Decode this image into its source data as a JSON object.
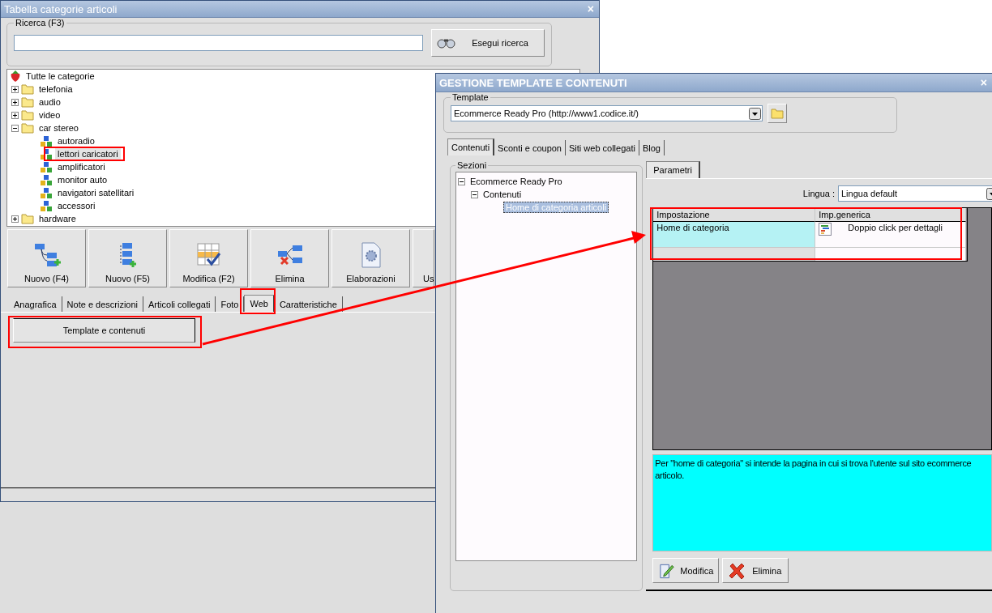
{
  "main_window": {
    "title": "Tabella categorie articoli",
    "close": "×",
    "search": {
      "label": "Ricerca (F3)",
      "button": "Esegui ricerca"
    },
    "tree": [
      {
        "label": "Tutte le categorie",
        "children": [
          {
            "label": "telefonia",
            "expanded": false
          },
          {
            "label": "audio",
            "expanded": false
          },
          {
            "label": "video",
            "expanded": false
          },
          {
            "label": "car stereo",
            "expanded": true,
            "children": [
              {
                "label": "autoradio",
                "selected": false
              },
              {
                "label": "lettori caricatori",
                "selected": true
              },
              {
                "label": "amplificatori",
                "selected": false
              },
              {
                "label": "monitor auto",
                "selected": false
              },
              {
                "label": "navigatori satellitari",
                "selected": false
              },
              {
                "label": "accessori",
                "selected": false
              }
            ]
          },
          {
            "label": "hardware",
            "expanded": false
          }
        ]
      }
    ],
    "toolbar": [
      {
        "label": "Nuovo (F4)"
      },
      {
        "label": "Nuovo (F5)"
      },
      {
        "label": "Modifica (F2)"
      },
      {
        "label": "Elimina"
      },
      {
        "label": "Elaborazioni"
      },
      {
        "label": "Us"
      }
    ],
    "tabs": [
      {
        "label": "Anagrafica",
        "selected": false
      },
      {
        "label": "Note e descrizioni",
        "selected": false
      },
      {
        "label": "Articoli collegati",
        "selected": false
      },
      {
        "label": "Foto",
        "selected": false
      },
      {
        "label": "Web",
        "selected": true
      },
      {
        "label": "Caratteristiche",
        "selected": false
      }
    ],
    "panel_button": "Template e contenuti"
  },
  "dialog": {
    "title": "GESTIONE TEMPLATE E CONTENUTI",
    "close": "×",
    "template": {
      "label": "Template",
      "value": "Ecommerce Ready Pro (http://www1.codice.it/)"
    },
    "tabs": [
      {
        "label": "Contenuti",
        "selected": true
      },
      {
        "label": "Sconti e coupon",
        "selected": false
      },
      {
        "label": "Siti web collegati",
        "selected": false
      },
      {
        "label": "Blog",
        "selected": false
      }
    ],
    "sections": {
      "label": "Sezioni",
      "tree": [
        {
          "label": "Ecommerce Ready Pro",
          "expanded": true,
          "children": [
            {
              "label": "Contenuti",
              "expanded": true,
              "children": [
                {
                  "label": "Home di categoria articoli",
                  "selected": true
                }
              ]
            }
          ]
        }
      ]
    },
    "params_tab": {
      "label": "Parametri",
      "selected": true
    },
    "language": {
      "label": "Lingua :",
      "value": "Lingua default"
    },
    "grid": {
      "columns": [
        "Impostazione",
        "Imp.generica"
      ],
      "rows": [
        {
          "cells": [
            "Home di categoria",
            "Doppio click per dettagli"
          ]
        }
      ]
    },
    "description_lines": [
      "Per \"home di categoria\" si intende la pagina in cui si trova l'utente sul sito ecommerce",
      "articolo."
    ],
    "buttons": [
      {
        "label": "Modifica"
      },
      {
        "label": "Elimina"
      }
    ]
  }
}
